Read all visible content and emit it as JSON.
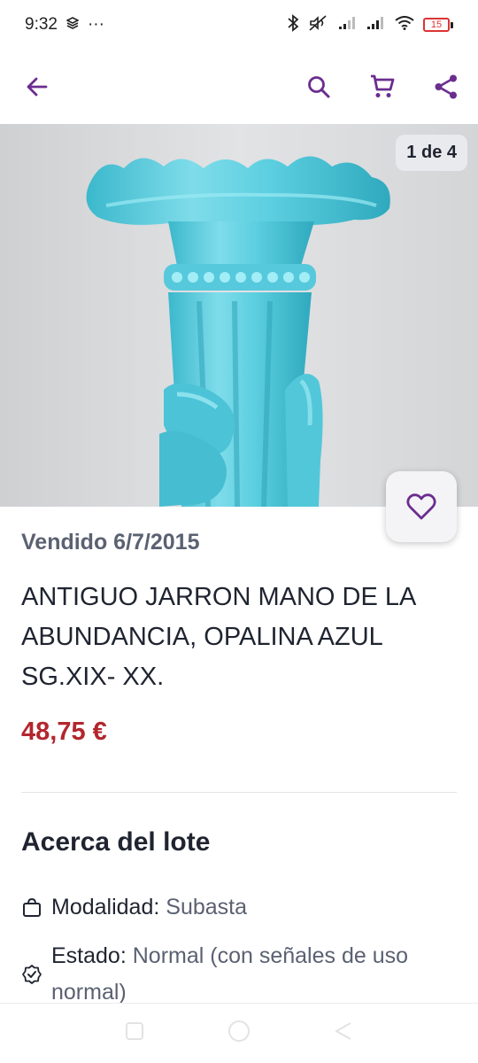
{
  "status_bar": {
    "time": "9:32",
    "dots": "···",
    "battery": "15",
    "icons": [
      "stack-icon",
      "bluetooth-icon",
      "mute-icon",
      "signal-icon",
      "signal-icon",
      "wifi-icon",
      "battery-icon"
    ]
  },
  "app_bar": {
    "back_icon": "arrow-left-icon",
    "actions": [
      "search-icon",
      "cart-icon",
      "share-icon"
    ],
    "accent_color": "#6b2d8f"
  },
  "gallery": {
    "counter": "1 de 4"
  },
  "favorite": {
    "icon": "heart-outline-icon"
  },
  "lot": {
    "sold": "Vendido 6/7/2015",
    "title": "ANTIGUO JARRON MANO DE LA ABUNDANCIA, OPALINA AZUL SG.XIX- XX.",
    "price": "48,75 €",
    "price_color": "#b3262e"
  },
  "about": {
    "heading": "Acerca del lote",
    "details": [
      {
        "icon": "bag-icon",
        "label": "Modalidad:",
        "value": "Subasta"
      },
      {
        "icon": "badge-check-icon",
        "label": "Estado:",
        "value": "Normal (con señales de uso normal)"
      }
    ]
  },
  "nav": [
    "recents-icon",
    "home-icon",
    "back-icon"
  ]
}
